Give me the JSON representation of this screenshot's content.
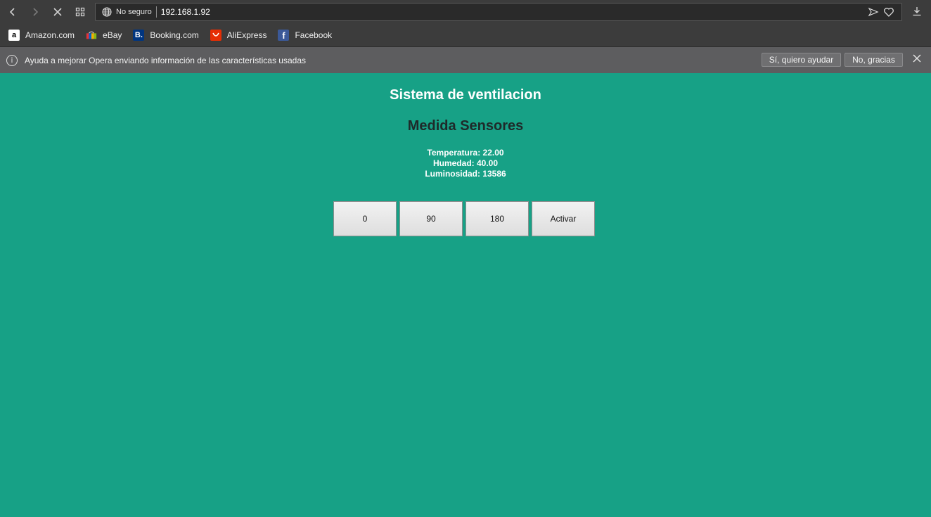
{
  "browser": {
    "security_label": "No seguro",
    "url": "192.168.1.92",
    "bookmarks": [
      {
        "label": "Amazon.com",
        "icon": "amazon-icon",
        "color": "#ffffff"
      },
      {
        "label": "eBay",
        "icon": "ebay-icon",
        "color": "#e53238"
      },
      {
        "label": "Booking.com",
        "icon": "booking-icon",
        "color": "#003580"
      },
      {
        "label": "AliExpress",
        "icon": "aliexpress-icon",
        "color": "#e62e04"
      },
      {
        "label": "Facebook",
        "icon": "facebook-icon",
        "color": "#3b5998"
      }
    ],
    "infobar": {
      "message": "Ayuda a mejorar Opera enviando información de las características usadas",
      "accept_label": "Sí, quiero ayudar",
      "decline_label": "No, gracias"
    }
  },
  "page": {
    "background": "#17a186",
    "title": "Sistema de ventilacion",
    "subtitle": "Medida Sensores",
    "temperature": "Temperatura: 22.00",
    "humidity": "Humedad: 40.00",
    "luminosity": "Luminosidad: 13586",
    "buttons": [
      "0",
      "90",
      "180",
      "Activar"
    ]
  }
}
